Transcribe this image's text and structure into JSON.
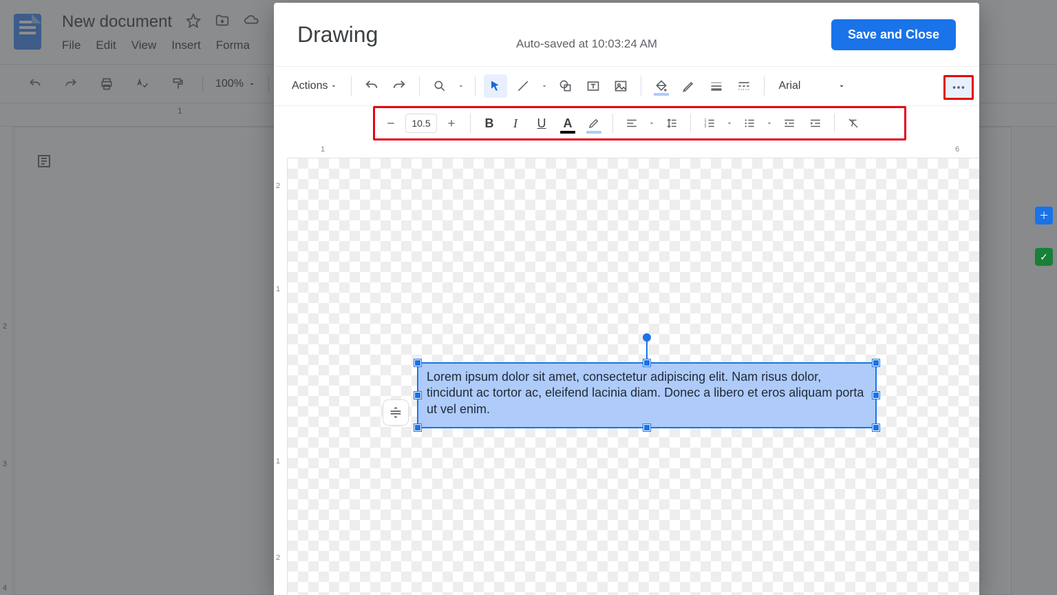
{
  "docs": {
    "title": "New document",
    "menu": [
      "File",
      "Edit",
      "View",
      "Insert",
      "Forma"
    ],
    "zoom": "100%"
  },
  "bg_ruler_h": [
    "1"
  ],
  "bg_ruler_v": [
    "2",
    "3",
    "4"
  ],
  "dialog": {
    "title": "Drawing",
    "status": "Auto-saved at 10:03:24 AM",
    "save_label": "Save and Close"
  },
  "toolbar": {
    "actions_label": "Actions",
    "font": "Arial",
    "font_size": "10.5"
  },
  "ruler_h": [
    "1",
    "6"
  ],
  "ruler_v": [
    "2",
    "1",
    "1",
    "2"
  ],
  "textbox_text": "Lorem ipsum dolor sit amet, consectetur adipiscing elit. Nam risus dolor, tincidunt ac tortor ac, eleifend lacinia diam. Donec a libero et eros aliquam porta ut vel enim."
}
